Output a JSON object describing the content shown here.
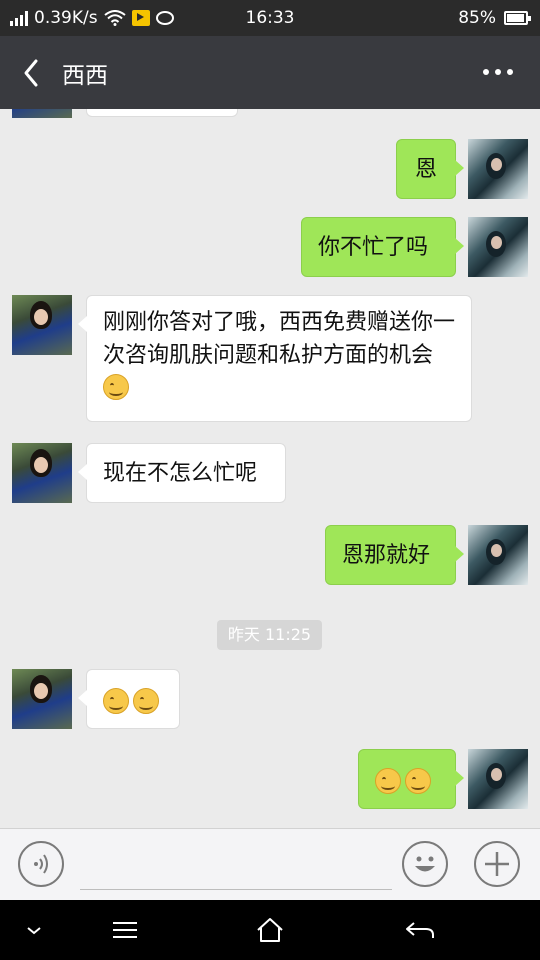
{
  "status_bar": {
    "speed": "0.39K/s",
    "time": "16:33",
    "battery": "85%"
  },
  "header": {
    "title": "西西"
  },
  "messages": [
    {
      "side": "left",
      "text": "刚刚你答对了哦，西西免费赠送你一次咨询肌肤问题和私护方面的机会"
    },
    {
      "side": "left",
      "text": "现在不怎么忙呢"
    },
    {
      "side": "right",
      "text": "恩"
    },
    {
      "side": "right",
      "text": "你不忙了吗"
    },
    {
      "side": "right",
      "text": "恩那就好"
    }
  ],
  "timestamp": "昨天 11:25",
  "input": {
    "value": ""
  },
  "icons": {
    "back": "back-arrow-icon",
    "more": "more-icon",
    "voice": "voice-icon",
    "emoji": "emoji-icon",
    "plus": "plus-icon"
  },
  "colors": {
    "header_bg": "#393a3f",
    "my_bubble": "#9fe658",
    "their_bubble": "#ffffff",
    "chat_bg": "#ebebeb"
  }
}
